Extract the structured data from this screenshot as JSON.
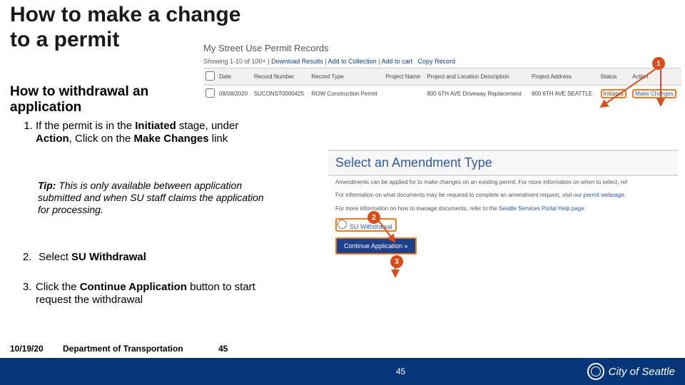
{
  "title_line1": "How to make a change",
  "title_line2": "to a permit",
  "subtitle_line1": "How to withdrawal an",
  "subtitle_line2": "application",
  "step1_pre": "If the permit is in the ",
  "step1_b1": "Initiated",
  "step1_mid1": " stage, under ",
  "step1_b2": "Action",
  "step1_mid2": ", Click on the ",
  "step1_b3": "Make Changes",
  "step1_post": " link",
  "tip_b": "Tip:",
  "tip_text": " This is only available between application submitted and when SU staff claims the application for processing.",
  "step2_num": "2.",
  "step2_pre": "Select ",
  "step2_b": "SU Withdrawal",
  "step3_num": "3.",
  "step3_pre": "Click the ",
  "step3_b": "Continue Application",
  "step3_post": " button to start request the withdrawal",
  "shot1": {
    "header": "My Street Use Permit Records",
    "row_info": "Showing 1-10 of 100+",
    "links": {
      "download": "Download Results",
      "add_coll": "Add to Collection",
      "add_cart": "Add to cart",
      "copy": "Copy Record"
    },
    "cols": {
      "date": "Date",
      "recnum": "Record Number",
      "rectype": "Record Type",
      "projname": "Project Name",
      "projloc": "Project and Location Description",
      "addr": "Project Address",
      "status": "Status",
      "action": "Action"
    },
    "row": {
      "date": "08/08/2020",
      "recnum": "SUCONST0000425",
      "rectype": "ROW Construction Permit",
      "projname": "",
      "projloc": "800 6TH AVE Driveway Replacement",
      "addr": "800 6TH AVE SEATTLE",
      "status": "Initiated",
      "action": "Make Changes"
    }
  },
  "shot2": {
    "title": "Select an Amendment Type",
    "p1": "Amendments can be applied for to make changes on an existing permit. For more information on when to select, ref",
    "p2_a": "For information on what documents may be required to complete an amendment request, visit ",
    "p2_link": "our permit webpage.",
    "p3_a": "For more information on how to manage documents, refer to the ",
    "p3_link": "Seattle Services Portal Help page.",
    "radio": "SU Withdrawal",
    "button": "Continue Application »"
  },
  "callouts": {
    "c1": "1",
    "c2": "2",
    "c3": "3"
  },
  "footer": {
    "date": "10/19/20",
    "dept": "Department of Transportation",
    "pg1": "45",
    "pg2": "45",
    "city": "City of Seattle"
  }
}
